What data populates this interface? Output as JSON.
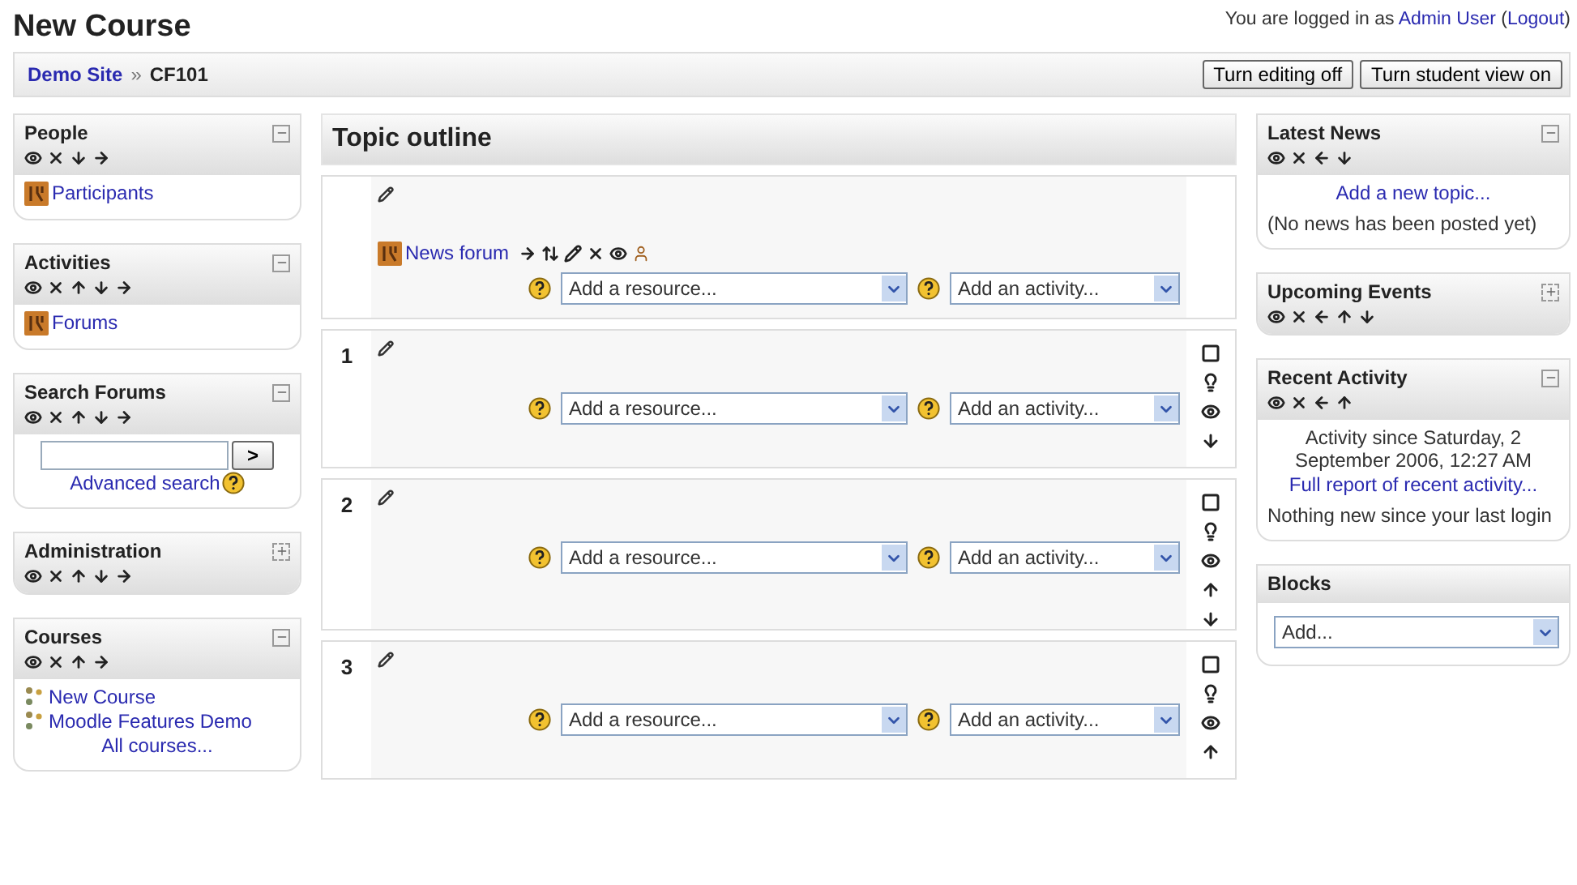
{
  "header": {
    "title": "New Course",
    "login": [
      {
        "text": "You are logged in as ",
        "link": false
      },
      {
        "text": "Admin User",
        "link": true
      },
      {
        "text": " (",
        "link": false
      },
      {
        "text": "Logout",
        "link": true
      },
      {
        "text": ")",
        "link": false
      }
    ]
  },
  "navbar": {
    "breadcrumb": [
      {
        "text": "Demo Site",
        "link": true
      },
      {
        "text": "CF101",
        "link": false
      }
    ],
    "separator": "»",
    "buttons": [
      "Turn editing off",
      "Turn student view on"
    ]
  },
  "left_blocks": [
    {
      "title": "People",
      "kind": "editable",
      "expanded": true,
      "controls": [
        {
          "kind": "hide"
        },
        {
          "kind": "delete"
        },
        {
          "kind": "down"
        },
        {
          "kind": "right"
        }
      ],
      "items": [
        {
          "kind": "people-link",
          "text": "Participants"
        }
      ]
    },
    {
      "title": "Activities",
      "kind": "editable",
      "expanded": true,
      "controls": [
        {
          "kind": "hide"
        },
        {
          "kind": "delete"
        },
        {
          "kind": "up"
        },
        {
          "kind": "down"
        },
        {
          "kind": "right"
        }
      ],
      "items": [
        {
          "kind": "forum-link",
          "text": "Forums"
        }
      ]
    },
    {
      "title": "Search Forums",
      "kind": "editable",
      "expanded": true,
      "controls": [
        {
          "kind": "hide"
        },
        {
          "kind": "delete"
        },
        {
          "kind": "up"
        },
        {
          "kind": "down"
        },
        {
          "kind": "right"
        }
      ],
      "items": [
        {
          "kind": "search",
          "button": ">",
          "text": "Advanced search"
        }
      ]
    },
    {
      "title": "Administration",
      "kind": "editable",
      "expanded": false,
      "controls": [
        {
          "kind": "hide"
        },
        {
          "kind": "delete"
        },
        {
          "kind": "up"
        },
        {
          "kind": "down"
        },
        {
          "kind": "right"
        }
      ]
    },
    {
      "title": "Courses",
      "kind": "editable",
      "expanded": true,
      "controls": [
        {
          "kind": "hide"
        },
        {
          "kind": "delete"
        },
        {
          "kind": "up"
        },
        {
          "kind": "right"
        }
      ],
      "items": [
        {
          "kind": "course-link",
          "text": "New Course"
        },
        {
          "kind": "course-link",
          "text": "Moodle Features Demo"
        },
        {
          "kind": "center-link",
          "text": "All courses..."
        }
      ]
    }
  ],
  "center": {
    "title": "Topic outline",
    "sections": [
      {
        "items": [
          {
            "kind": "forum-link",
            "text": "News forum",
            "controls": [
              {
                "kind": "right"
              },
              {
                "kind": "move"
              },
              {
                "kind": "edit"
              },
              {
                "kind": "delete"
              },
              {
                "kind": "hide"
              },
              {
                "kind": "group"
              }
            ]
          }
        ],
        "resource": "Add a resource...",
        "activity": "Add an activity..."
      },
      {
        "number": "1",
        "resource": "Add a resource...",
        "activity": "Add an activity...",
        "side_controls": [
          {
            "kind": "highlight"
          },
          {
            "kind": "bulb"
          },
          {
            "kind": "hide"
          },
          {
            "kind": "down"
          }
        ]
      },
      {
        "number": "2",
        "resource": "Add a resource...",
        "activity": "Add an activity...",
        "side_controls": [
          {
            "kind": "highlight"
          },
          {
            "kind": "bulb"
          },
          {
            "kind": "hide"
          },
          {
            "kind": "up"
          },
          {
            "kind": "down"
          }
        ]
      },
      {
        "number": "3",
        "resource": "Add a resource...",
        "activity": "Add an activity...",
        "side_controls": [
          {
            "kind": "highlight"
          },
          {
            "kind": "bulb"
          },
          {
            "kind": "hide"
          },
          {
            "kind": "up"
          }
        ]
      }
    ]
  },
  "right_blocks": [
    {
      "title": "Latest News",
      "kind": "editable",
      "expanded": true,
      "controls": [
        {
          "kind": "hide"
        },
        {
          "kind": "delete"
        },
        {
          "kind": "left"
        },
        {
          "kind": "down"
        }
      ],
      "items": [
        {
          "kind": "center-link",
          "text": "Add a new topic..."
        },
        {
          "kind": "text",
          "text": "(No news has been posted yet)"
        }
      ]
    },
    {
      "title": "Upcoming Events",
      "kind": "editable",
      "expanded": false,
      "controls": [
        {
          "kind": "hide"
        },
        {
          "kind": "delete"
        },
        {
          "kind": "left"
        },
        {
          "kind": "up"
        },
        {
          "kind": "down"
        }
      ]
    },
    {
      "title": "Recent Activity",
      "kind": "editable",
      "expanded": true,
      "controls": [
        {
          "kind": "hide"
        },
        {
          "kind": "delete"
        },
        {
          "kind": "left"
        },
        {
          "kind": "up"
        }
      ],
      "items": [
        {
          "kind": "center-text",
          "text": "Activity since Saturday, 2 September 2006, 12:27 AM"
        },
        {
          "kind": "center-link",
          "text": "Full report of recent activity..."
        },
        {
          "kind": "text",
          "text": "Nothing new since your last login"
        }
      ]
    },
    {
      "title": "Blocks",
      "kind": "static",
      "items": [
        {
          "kind": "select",
          "text": "Add..."
        }
      ]
    }
  ]
}
